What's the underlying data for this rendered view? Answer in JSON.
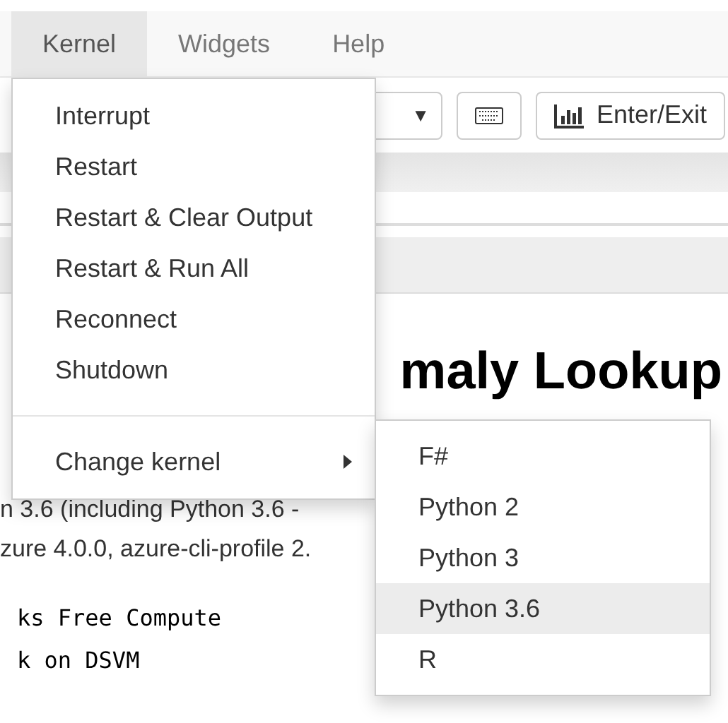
{
  "menubar": [
    {
      "label": "Kernel",
      "selected": true
    },
    {
      "label": "Widgets",
      "selected": false
    },
    {
      "label": "Help",
      "selected": false
    }
  ],
  "toolbar": {
    "dropdown_arrow": "▼",
    "button_label": "Enter/Exit"
  },
  "notebook": {
    "heading": "maly Lookup",
    "lines": [
      "n 3.6 (including Python 3.6 -",
      "zure 4.0.0, azure-cli-profile 2."
    ],
    "code_lines": [
      "ks Free Compute",
      "k on DSVM"
    ]
  },
  "kernel_menu": {
    "items": [
      {
        "label": "Interrupt",
        "kind": "item"
      },
      {
        "label": "Restart",
        "kind": "item"
      },
      {
        "label": "Restart & Clear Output",
        "kind": "item"
      },
      {
        "label": "Restart & Run All",
        "kind": "item"
      },
      {
        "label": "Reconnect",
        "kind": "item"
      },
      {
        "label": "Shutdown",
        "kind": "item"
      },
      {
        "kind": "divider"
      },
      {
        "label": "Change kernel",
        "kind": "submenu"
      }
    ]
  },
  "kernel_submenu": {
    "items": [
      {
        "label": "F#",
        "selected": false
      },
      {
        "label": "Python 2",
        "selected": false
      },
      {
        "label": "Python 3",
        "selected": false
      },
      {
        "label": "Python 3.6",
        "selected": true
      },
      {
        "label": "R",
        "selected": false
      }
    ]
  }
}
